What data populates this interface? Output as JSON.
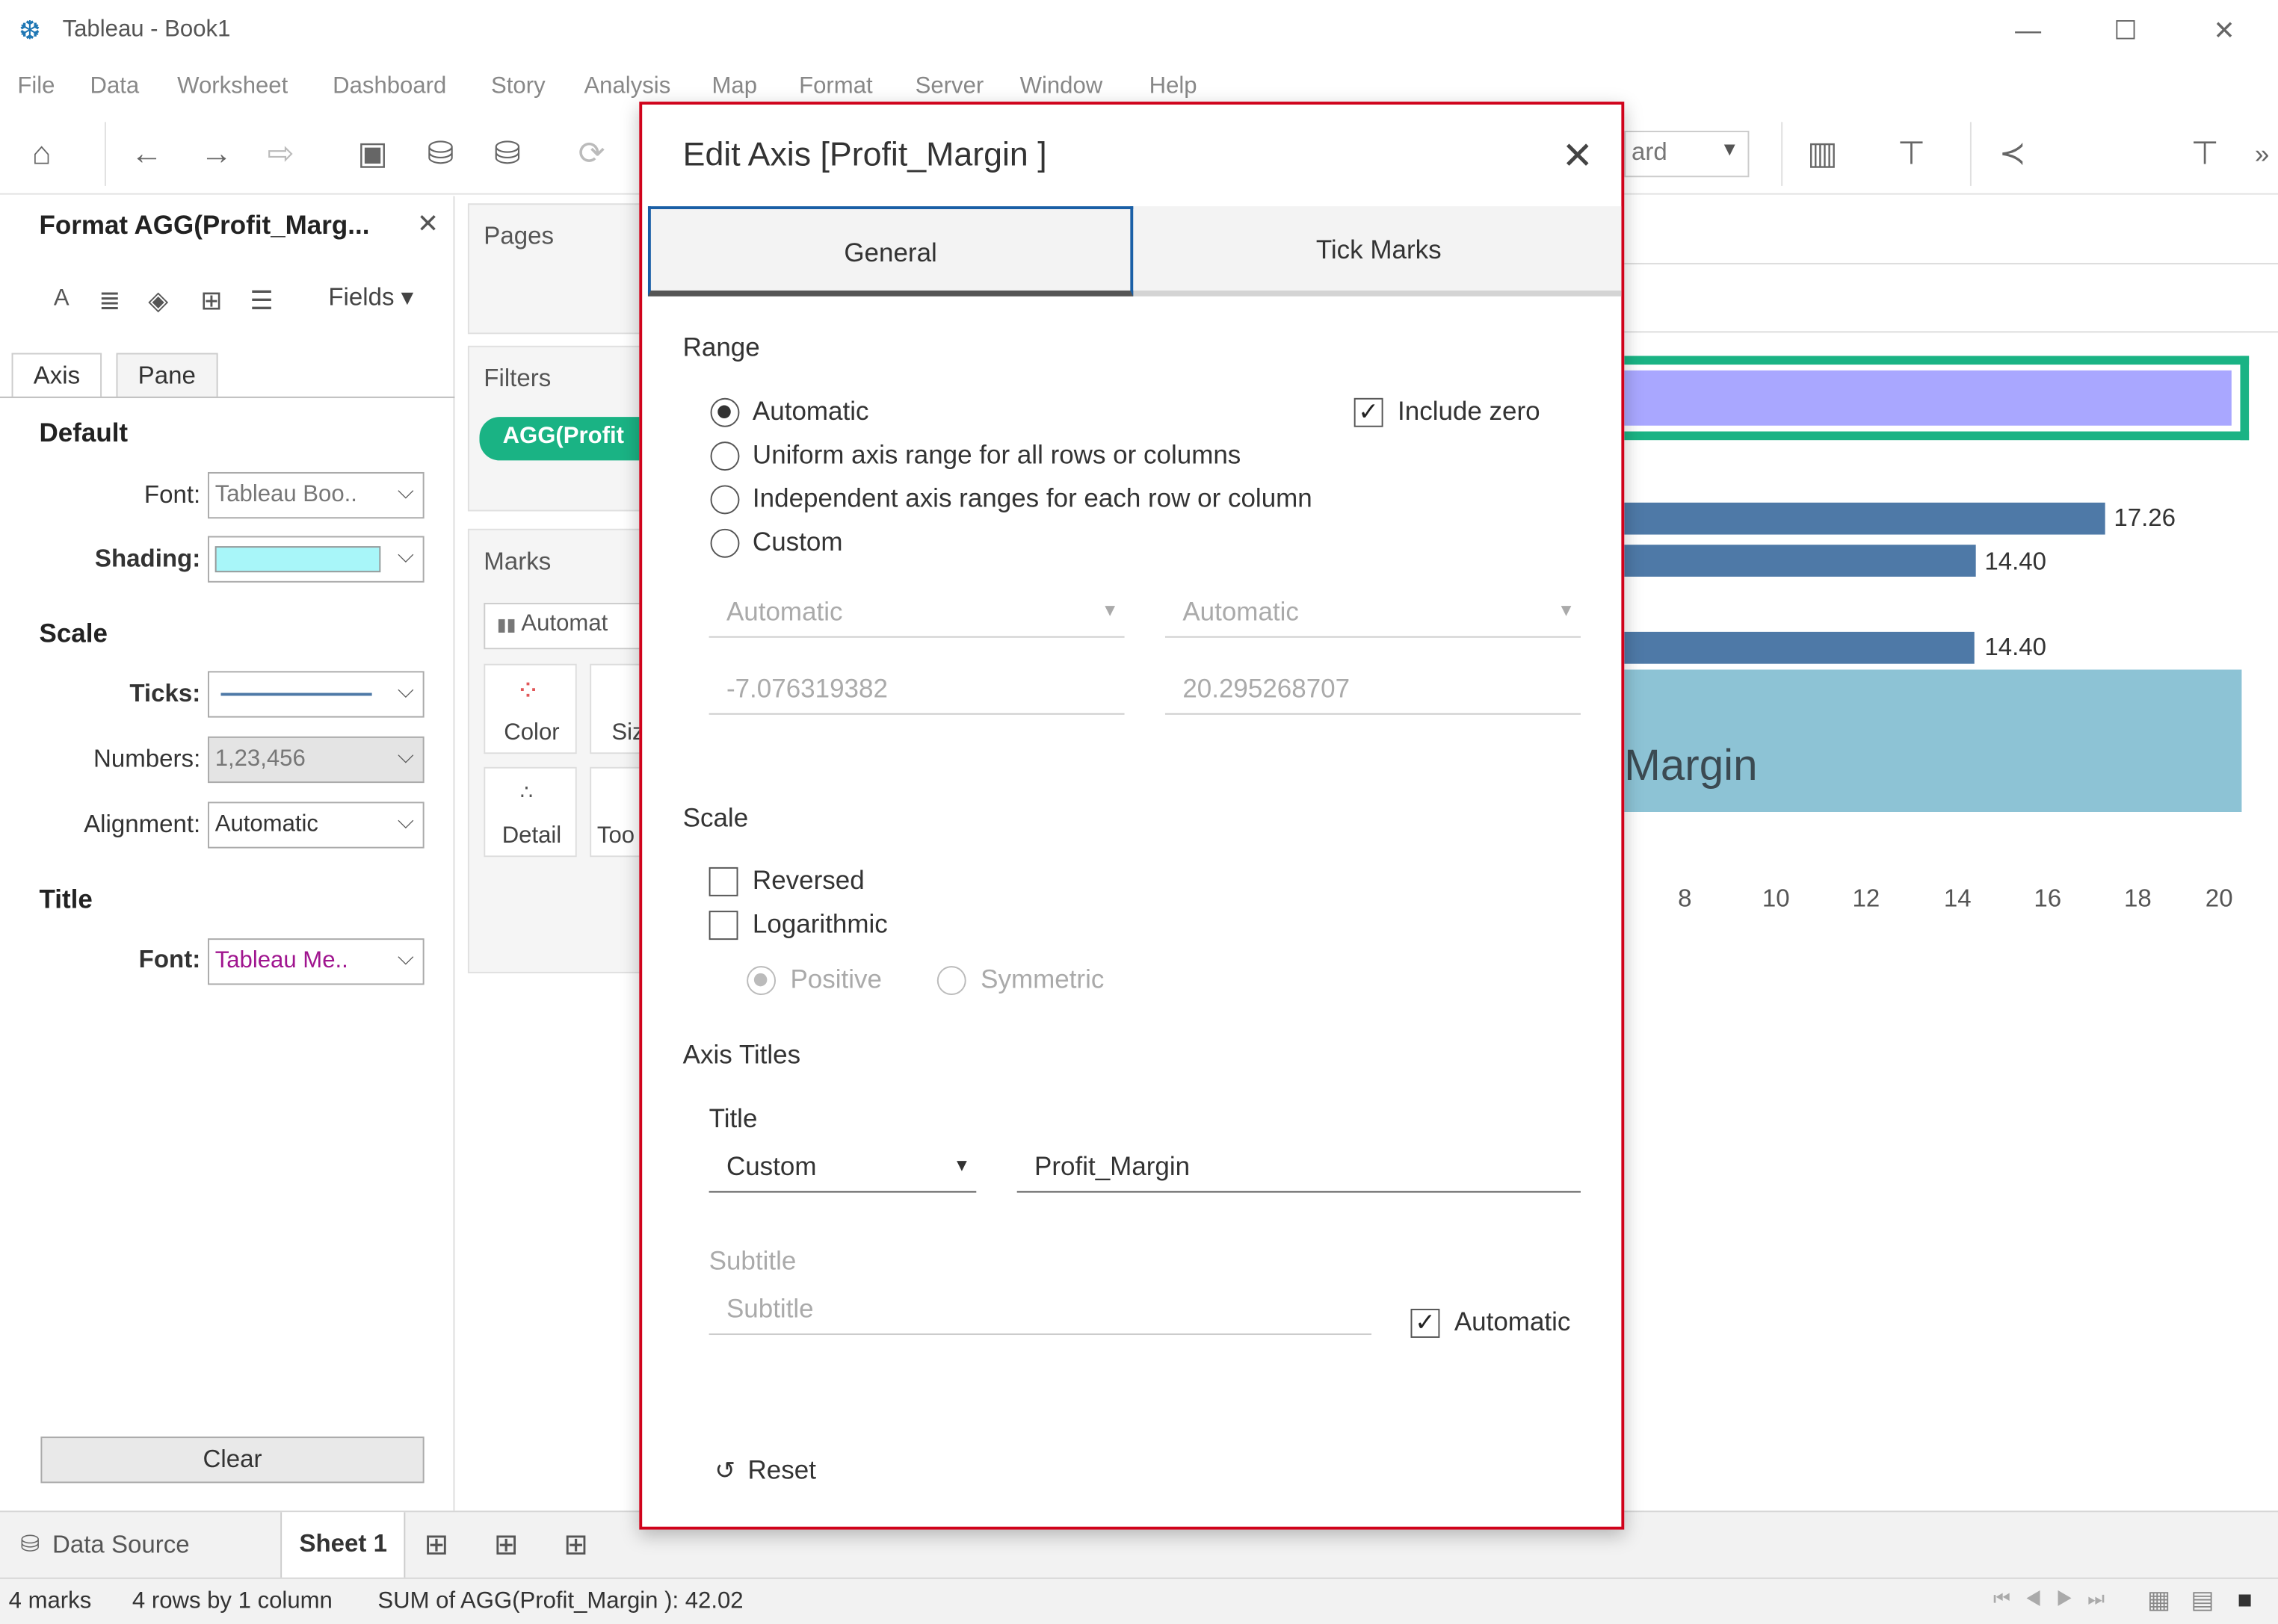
{
  "window": {
    "title": "Tableau - Book1",
    "minimize": "—",
    "maximize": "☐",
    "close": "✕"
  },
  "menu": [
    "File",
    "Data",
    "Worksheet",
    "Dashboard",
    "Story",
    "Analysis",
    "Map",
    "Format",
    "Server",
    "Window",
    "Help"
  ],
  "toolbar": {
    "standard_select": "ard",
    "more": "»"
  },
  "format_pane": {
    "title": "Format AGG(Profit_Marg...",
    "close": "✕",
    "fields_label": "Fields ▾",
    "tabs": [
      "Axis",
      "Pane"
    ],
    "default_section": "Default",
    "font_label": "Font:",
    "font_value": "Tableau Boo..",
    "shading_label": "Shading:",
    "scale_section": "Scale",
    "ticks_label": "Ticks:",
    "numbers_label": "Numbers:",
    "numbers_value": "1,23,456",
    "alignment_label": "Alignment:",
    "alignment_value": "Automatic",
    "title_section": "Title",
    "title_font_label": "Font:",
    "title_font_value": "Tableau Me..",
    "clear_label": "Clear",
    "shading_color": "#a8f6f9",
    "title_font_color": "#a0158f"
  },
  "cards": {
    "pages": "Pages",
    "filters": "Filters",
    "filter_pill": "AGG(Profit",
    "marks": "Marks",
    "marks_type": "Automat",
    "color": "Color",
    "size": "Siz",
    "detail": "Detail",
    "tooltip": "Too"
  },
  "view": {
    "bar_labels": [
      "17.26",
      "14.40",
      "14.40"
    ],
    "ticks": [
      "8",
      "10",
      "12",
      "14",
      "16",
      "18",
      "20"
    ],
    "axis_title": "Margin"
  },
  "sheetbar": {
    "data_source": "Data Source",
    "sheet": "Sheet 1"
  },
  "status": {
    "marks": "4 marks",
    "rows": "4 rows by 1 column",
    "sum": "SUM of AGG(Profit_Margin ): 42.02"
  },
  "dialog": {
    "title": "Edit Axis [Profit_Margin ]",
    "close": "✕",
    "tabs": [
      "General",
      "Tick Marks"
    ],
    "range_section": "Range",
    "range_options": [
      "Automatic",
      "Uniform axis range for all rows or columns",
      "Independent axis ranges for each row or column",
      "Custom"
    ],
    "include_zero": "Include zero",
    "start_select": "Automatic",
    "end_select": "Automatic",
    "start_value": "-7.076319382",
    "end_value": "20.295268707",
    "scale_section": "Scale",
    "reversed": "Reversed",
    "logarithmic": "Logarithmic",
    "positive": "Positive",
    "symmetric": "Symmetric",
    "axis_titles_section": "Axis Titles",
    "title_label": "Title",
    "title_mode": "Custom",
    "title_value": "Profit_Margin",
    "subtitle_label": "Subtitle",
    "subtitle_placeholder": "Subtitle",
    "automatic": "Automatic",
    "reset": "Reset"
  }
}
